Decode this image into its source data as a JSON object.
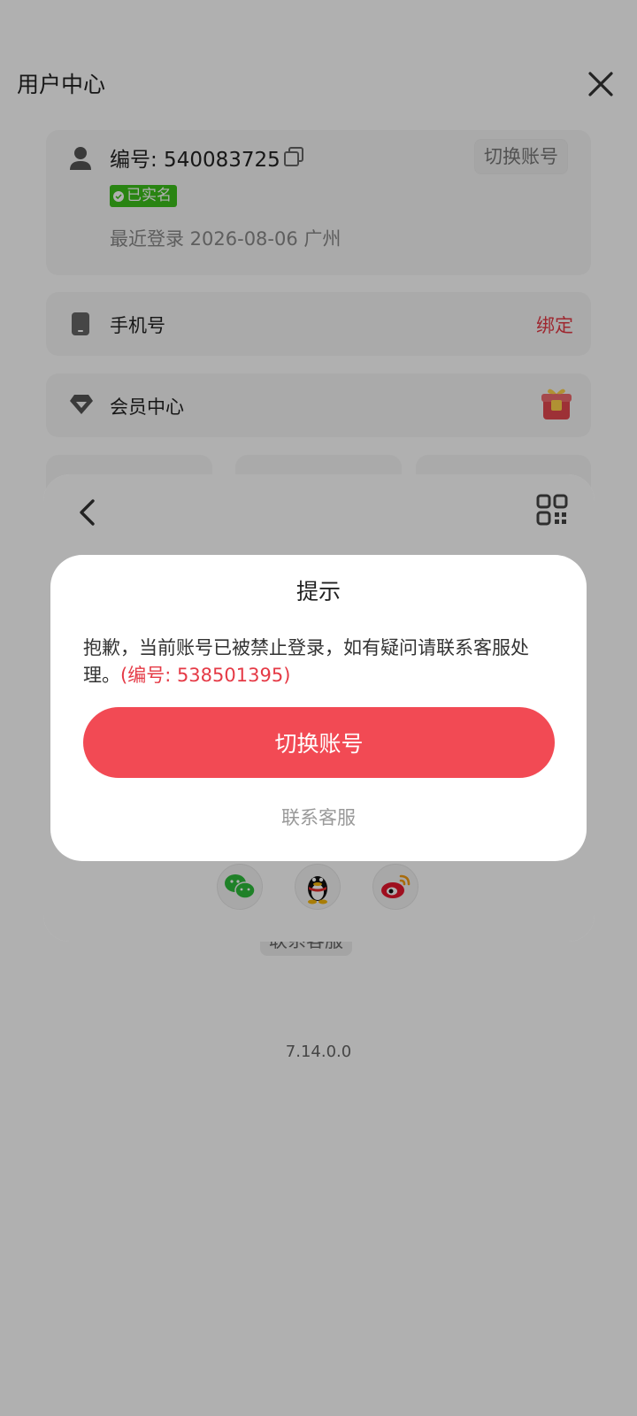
{
  "header": {
    "title": "用户中心"
  },
  "user_card": {
    "id_text": "编号: 540083725",
    "switch_label": "切换账号",
    "verified_label": "已实名",
    "last_login": "最近登录 2026-08-06 广州"
  },
  "phone_row": {
    "label": "手机号",
    "action": "绑定"
  },
  "vip_row": {
    "label": "会员中心"
  },
  "contact_bg_label": "联系客服",
  "version": "7.14.0.0",
  "dialog": {
    "title": "提示",
    "message": "抱歉，当前账号已被禁止登录，如有疑问请联系客服处理。",
    "code_text": "(编号: 538501395)",
    "primary_button": "切换账号",
    "secondary_link": "联系客服"
  },
  "colors": {
    "accent_red": "#f24a54",
    "verified_green": "#3cbf1b",
    "wechat_green": "#2dbb3a",
    "weibo_red": "#e6162d"
  },
  "icons": {
    "close": "close-icon",
    "avatar": "user-icon",
    "copy": "copy-icon",
    "phone": "phone-icon",
    "vip": "diamond-icon",
    "gift": "gift-icon",
    "back": "chevron-left-icon",
    "qr": "qr-code-icon",
    "wechat": "wechat-icon",
    "qq": "qq-icon",
    "weibo": "weibo-icon"
  }
}
